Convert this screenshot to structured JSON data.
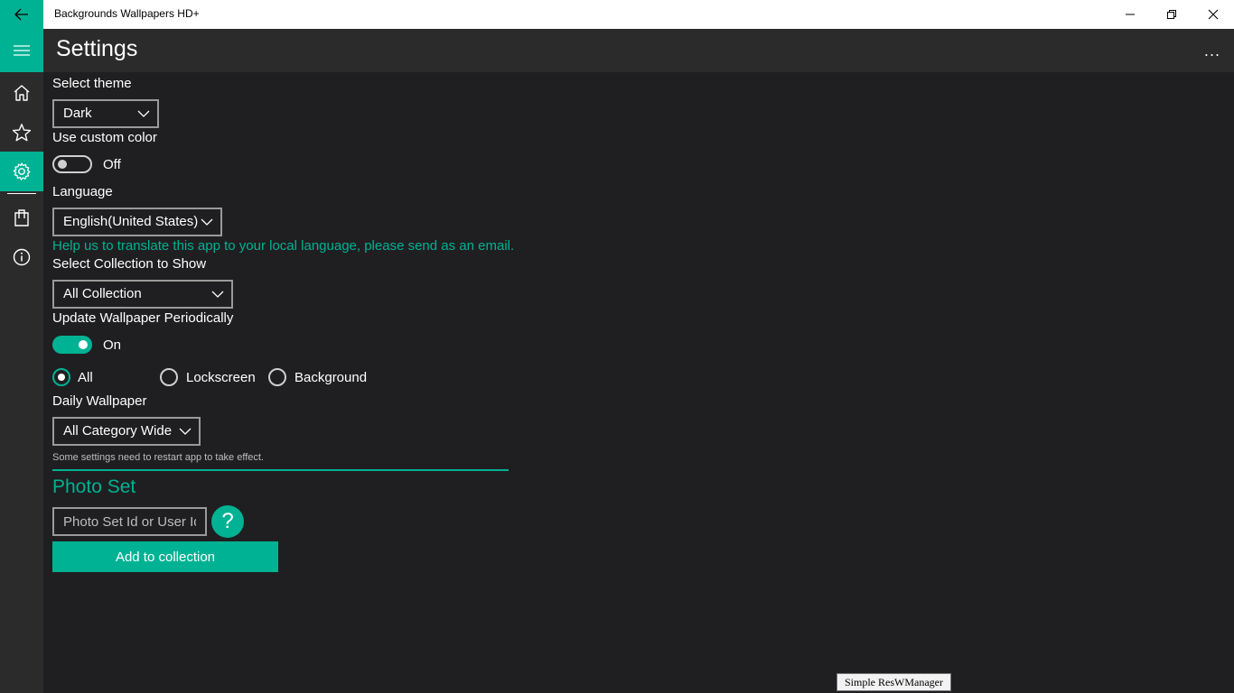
{
  "window": {
    "title": "Backgrounds Wallpapers HD+"
  },
  "header": {
    "title": "Settings",
    "more": "..."
  },
  "nav": {
    "items": [
      {
        "name": "home",
        "icon": "home-icon"
      },
      {
        "name": "favorites",
        "icon": "star-icon"
      },
      {
        "name": "settings",
        "icon": "gear-icon",
        "active": true
      },
      {
        "name": "store",
        "icon": "shopping-bag-icon"
      },
      {
        "name": "about",
        "icon": "info-icon"
      }
    ]
  },
  "settings": {
    "theme": {
      "label": "Select theme",
      "value": "Dark"
    },
    "custom_color": {
      "label": "Use custom color",
      "state": "Off"
    },
    "language": {
      "label": "Language",
      "value": "English(United States)",
      "help": "Help us to translate this app to your local language, please send as an email."
    },
    "collection": {
      "label": "Select Collection to Show",
      "value": "All Collection"
    },
    "update": {
      "label": "Update Wallpaper Periodically",
      "state": "On"
    },
    "targets": {
      "options": [
        "All",
        "Lockscreen",
        "Background"
      ],
      "selected": "All"
    },
    "daily": {
      "label": "Daily Wallpaper",
      "value": "All Category Wide"
    },
    "note": "Some settings need to restart app to take effect."
  },
  "photo_set": {
    "title": "Photo Set",
    "placeholder": "Photo Set Id or User Id",
    "help": "?",
    "add_label": "Add to collection"
  },
  "tooltip": "Simple ResWManager",
  "colors": {
    "accent": "#00b294",
    "background": "#1f1f21",
    "pane": "#2b2b2b"
  }
}
